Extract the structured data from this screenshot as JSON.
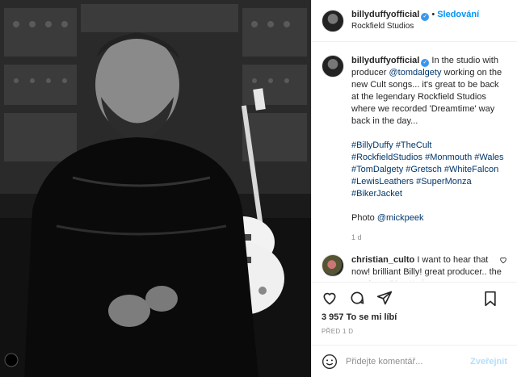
{
  "post": {
    "username": "billyduffyofficial",
    "follow_label": "Sledování",
    "location": "Rockfield Studios",
    "caption": {
      "username": "billyduffyofficial",
      "text_before": "In the studio with producer",
      "mention": "@tomdalgety",
      "text_after": "working on the new Cult songs... it's great to be back at the legendary Rockfield Studios where we recorded 'Dreamtime' way back in the day...",
      "hashtags": "#BillyDuffy #TheCult #RockfieldStudios #Monmouth #Wales #TomDalgety #Gretsch #WhiteFalcon #LewisLeathers #SuperMonza #BikerJacket",
      "photo_label": "Photo",
      "photo_mention": "@mickpeek",
      "time": "1 d"
    },
    "comment": {
      "username": "christian_culto",
      "text": "I want to hear that now! brilliant Billy! great producer.. the guy from Ghost! 👍"
    },
    "likes": "3 957 To se mi líbí",
    "date": "PŘED 1 D",
    "add_comment_placeholder": "Přidejte komentář...",
    "publish_label": "Zveřejnit",
    "icons": [
      "verified-badge",
      "heart-icon",
      "comment-icon",
      "share-icon",
      "bookmark-icon",
      "emoji-icon"
    ]
  }
}
